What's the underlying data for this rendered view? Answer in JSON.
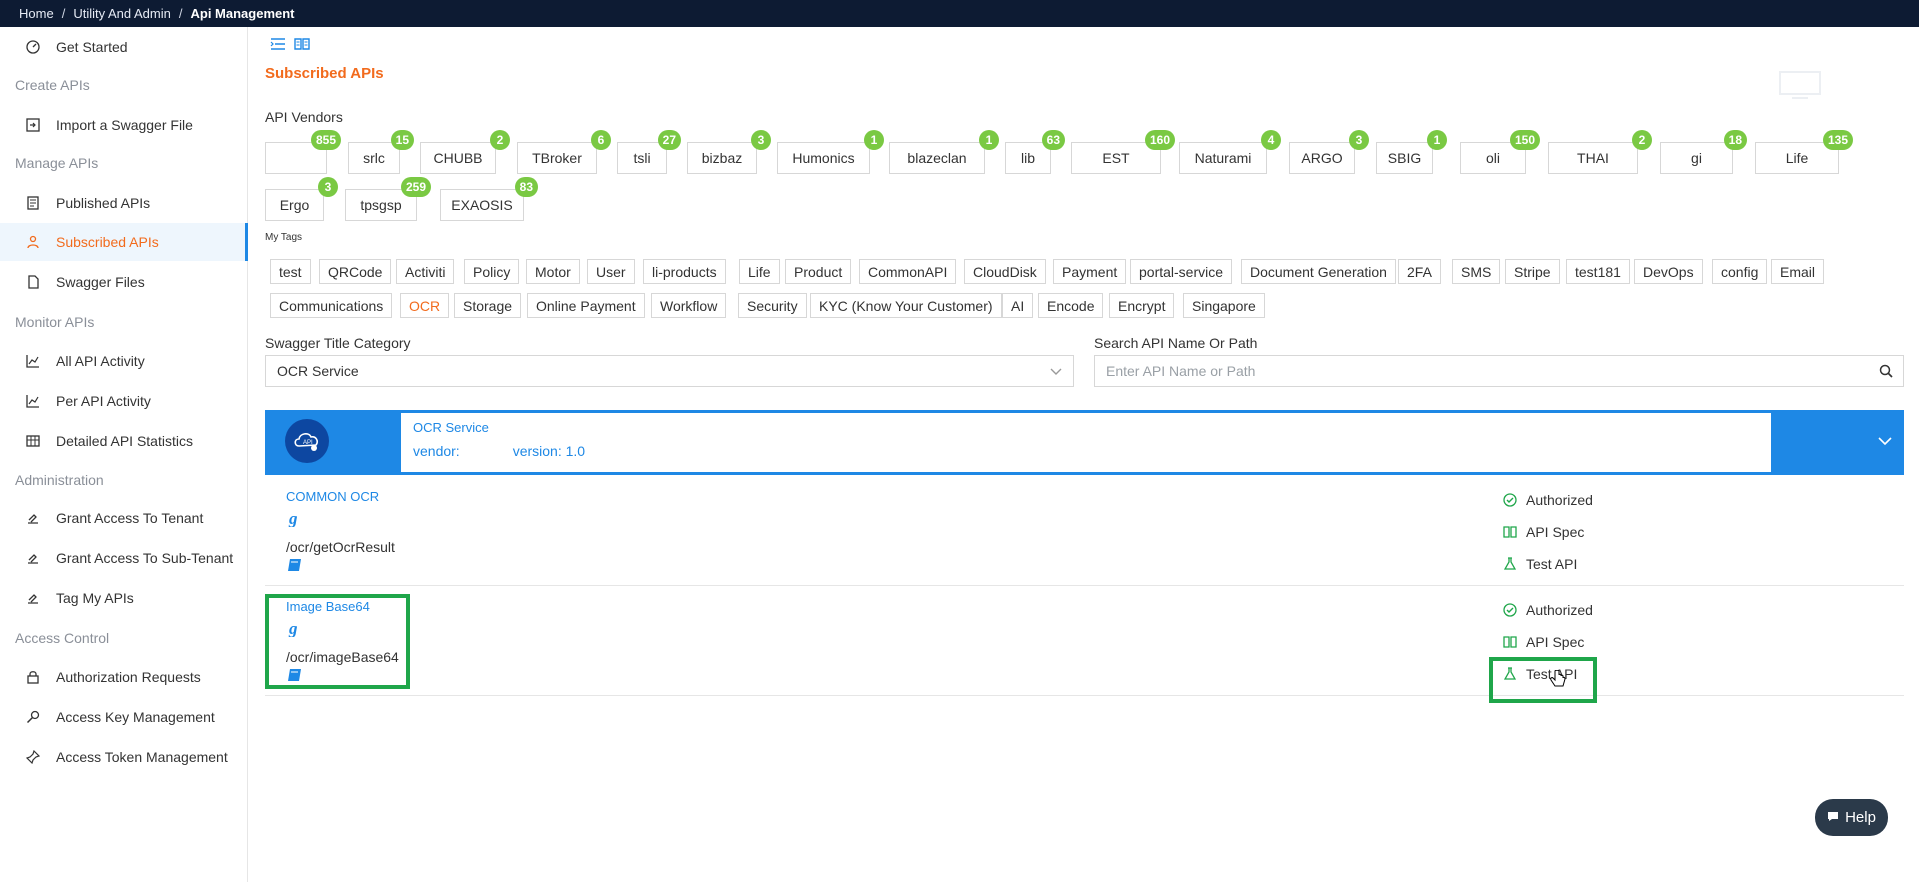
{
  "breadcrumb": [
    "Home",
    "Utility And Admin",
    "Api Management"
  ],
  "sidebar": {
    "get_started": "Get Started",
    "sections": {
      "create": "Create APIs",
      "manage": "Manage APIs",
      "monitor": "Monitor APIs",
      "admin": "Administration",
      "access": "Access Control"
    },
    "items": {
      "import": "Import a Swagger File",
      "published": "Published APIs",
      "subscribed": "Subscribed APIs",
      "swagger_files": "Swagger Files",
      "all_activity": "All API Activity",
      "per_activity": "Per API Activity",
      "detailed_stats": "Detailed API Statistics",
      "grant_tenant": "Grant Access To Tenant",
      "grant_sub": "Grant Access To Sub-Tenant",
      "tag_apis": "Tag My APIs",
      "auth_requests": "Authorization Requests",
      "access_key": "Access Key Management",
      "access_token": "Access Token Management"
    }
  },
  "main": {
    "page_title": "Subscribed APIs",
    "vendors_label": "API Vendors",
    "tags_label": "My Tags",
    "vendors": [
      {
        "name": "",
        "count": "855"
      },
      {
        "name": "srlc",
        "count": "15"
      },
      {
        "name": "CHUBB",
        "count": "2"
      },
      {
        "name": "TBroker",
        "count": "6"
      },
      {
        "name": "tsli",
        "count": "27"
      },
      {
        "name": "bizbaz",
        "count": "3"
      },
      {
        "name": "Humonics",
        "count": "1"
      },
      {
        "name": "blazeclan",
        "count": "1"
      },
      {
        "name": "lib",
        "count": "63"
      },
      {
        "name": "EST",
        "count": "160"
      },
      {
        "name": "Naturami",
        "count": "4"
      },
      {
        "name": "ARGO",
        "count": "3"
      },
      {
        "name": "SBIG",
        "count": "1"
      },
      {
        "name": "oli",
        "count": "150"
      },
      {
        "name": "THAI",
        "count": "2"
      },
      {
        "name": "gi",
        "count": "18"
      },
      {
        "name": "Life",
        "count": "135"
      },
      {
        "name": "Ergo",
        "count": "3"
      },
      {
        "name": "tpsgsp",
        "count": "259"
      },
      {
        "name": "EXAOSIS",
        "count": "83"
      }
    ],
    "tags": [
      "test",
      "QRCode",
      "Activiti",
      "Policy",
      "Motor",
      "User",
      "li-products",
      "Life",
      "Product",
      "CommonAPI",
      "CloudDisk",
      "Payment",
      "portal-service",
      "Document Generation",
      "2FA",
      "SMS",
      "Stripe",
      "test181",
      "DevOps",
      "config",
      "Email",
      "Communications",
      "OCR",
      "Storage",
      "Online Payment",
      "Workflow",
      "Security",
      "KYC (Know Your Customer)",
      "AI",
      "Encode",
      "Encrypt",
      "Singapore"
    ],
    "selected_tag": "OCR",
    "category_label": "Swagger Title Category",
    "category_value": "OCR Service",
    "search_label": "Search API Name Or Path",
    "search_placeholder": "Enter API Name or Path",
    "service": {
      "name": "OCR Service",
      "vendor_label": "vendor:",
      "version_label": "version: 1.0"
    },
    "apis": [
      {
        "name": "COMMON OCR",
        "path": "/ocr/getOcrResult",
        "authorized": "Authorized",
        "spec": "API Spec",
        "test": "Test API"
      },
      {
        "name": "Image Base64",
        "path": "/ocr/imageBase64",
        "authorized": "Authorized",
        "spec": "API Spec",
        "test": "Test API"
      }
    ],
    "help": "Help"
  },
  "colors": {
    "accent": "#f26b1d",
    "primary": "#1e88e5",
    "badge": "#7ac943",
    "highlight": "#1fa64a",
    "topbar": "#0d1b33"
  }
}
